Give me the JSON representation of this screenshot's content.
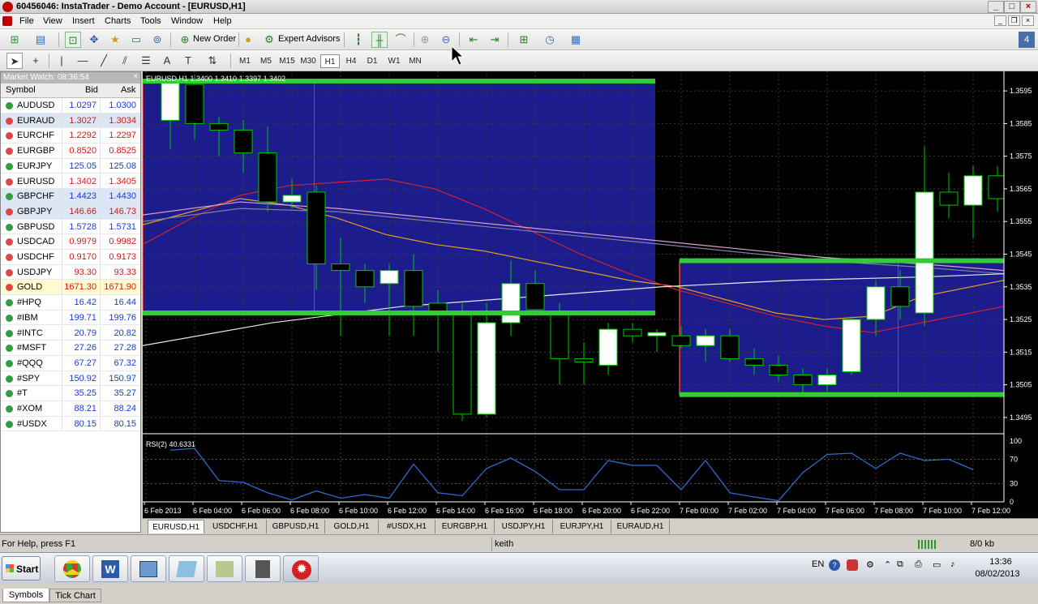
{
  "window": {
    "title": "60456046: InstaTrader - Demo Account - [EURUSD,H1]"
  },
  "menu": {
    "items": [
      "File",
      "View",
      "Insert",
      "Charts",
      "Tools",
      "Window",
      "Help"
    ]
  },
  "toolbar": {
    "new_order": "New Order",
    "expert_advisors": "Expert Advisors"
  },
  "timeframes": [
    "M1",
    "M5",
    "M15",
    "M30",
    "H1",
    "H4",
    "D1",
    "W1",
    "MN"
  ],
  "active_timeframe": "H1",
  "market_watch": {
    "title": "Market Watch: 08:36:54",
    "columns": [
      "Symbol",
      "Bid",
      "Ask"
    ],
    "rows": [
      {
        "symbol": "AUDUSD",
        "bid": "1.0297",
        "ask": "1.0300",
        "dir": "up"
      },
      {
        "symbol": "EURAUD",
        "bid": "1.3027",
        "ask": "1.3034",
        "dir": "down"
      },
      {
        "symbol": "EURCHF",
        "bid": "1.2292",
        "ask": "1.2297",
        "dir": "down"
      },
      {
        "symbol": "EURGBP",
        "bid": "0.8520",
        "ask": "0.8525",
        "dir": "down"
      },
      {
        "symbol": "EURJPY",
        "bid": "125.05",
        "ask": "125.08",
        "dir": "up"
      },
      {
        "symbol": "EURUSD",
        "bid": "1.3402",
        "ask": "1.3405",
        "dir": "down"
      },
      {
        "symbol": "GBPCHF",
        "bid": "1.4423",
        "ask": "1.4430",
        "dir": "up"
      },
      {
        "symbol": "GBPJPY",
        "bid": "146.66",
        "ask": "146.73",
        "dir": "down"
      },
      {
        "symbol": "GBPUSD",
        "bid": "1.5728",
        "ask": "1.5731",
        "dir": "up"
      },
      {
        "symbol": "USDCAD",
        "bid": "0.9979",
        "ask": "0.9982",
        "dir": "down"
      },
      {
        "symbol": "USDCHF",
        "bid": "0.9170",
        "ask": "0.9173",
        "dir": "down"
      },
      {
        "symbol": "USDJPY",
        "bid": "93.30",
        "ask": "93.33",
        "dir": "down"
      },
      {
        "symbol": "GOLD",
        "bid": "1671.30",
        "ask": "1671.90",
        "dir": "down"
      },
      {
        "symbol": "#HPQ",
        "bid": "16.42",
        "ask": "16.44",
        "dir": "up"
      },
      {
        "symbol": "#IBM",
        "bid": "199.71",
        "ask": "199.76",
        "dir": "up"
      },
      {
        "symbol": "#INTC",
        "bid": "20.79",
        "ask": "20.82",
        "dir": "up"
      },
      {
        "symbol": "#MSFT",
        "bid": "27.26",
        "ask": "27.28",
        "dir": "up"
      },
      {
        "symbol": "#QQQ",
        "bid": "67.27",
        "ask": "67.32",
        "dir": "up"
      },
      {
        "symbol": "#SPY",
        "bid": "150.92",
        "ask": "150.97",
        "dir": "up"
      },
      {
        "symbol": "#T",
        "bid": "35.25",
        "ask": "35.27",
        "dir": "up"
      },
      {
        "symbol": "#XOM",
        "bid": "88.21",
        "ask": "88.24",
        "dir": "up"
      },
      {
        "symbol": "#USDX",
        "bid": "80.15",
        "ask": "80.15",
        "dir": "up"
      }
    ],
    "tabs": [
      "Symbols",
      "Tick Chart"
    ]
  },
  "chart": {
    "header": "EURUSD,H1  1.3400 1.3410 1.3397 1.3402",
    "rsi_label": "RSI(2) 40.6331",
    "chart_tabs": [
      "EURUSD,H1",
      "USDCHF,H1",
      "GBPUSD,H1",
      "GOLD,H1",
      "#USDX,H1",
      "EURGBP,H1",
      "USDJPY,H1",
      "EURJPY,H1",
      "EURAUD,H1"
    ],
    "colors": {
      "bull": "#ffffff",
      "bear": "#000000",
      "candle_border": "#00c800",
      "box": "#1c1c8c",
      "box_border": "#ff3b30",
      "green_level": "#32cd32"
    }
  },
  "chart_data": {
    "type": "candlestick",
    "symbol": "EURUSD",
    "timeframe": "H1",
    "y_ticks": [
      "1.3595",
      "1.3585",
      "1.3575",
      "1.3565",
      "1.3555",
      "1.3545",
      "1.3535",
      "1.3525",
      "1.3515",
      "1.3505",
      "1.3495"
    ],
    "x_ticks": [
      "6 Feb 2013",
      "6 Feb 04:00",
      "6 Feb 06:00",
      "6 Feb 08:00",
      "6 Feb 10:00",
      "6 Feb 12:00",
      "6 Feb 14:00",
      "6 Feb 16:00",
      "6 Feb 18:00",
      "6 Feb 20:00",
      "6 Feb 22:00",
      "7 Feb 00:00",
      "7 Feb 02:00",
      "7 Feb 04:00",
      "7 Feb 06:00",
      "7 Feb 08:00",
      "7 Feb 10:00",
      "7 Feb 12:00"
    ],
    "candles": [
      {
        "o": 1.3586,
        "h": 1.3598,
        "l": 1.3577,
        "c": 1.3598
      },
      {
        "o": 1.3597,
        "h": 1.36,
        "l": 1.358,
        "c": 1.3585
      },
      {
        "o": 1.3585,
        "h": 1.3587,
        "l": 1.3575,
        "c": 1.3583
      },
      {
        "o": 1.3583,
        "h": 1.3586,
        "l": 1.357,
        "c": 1.3576
      },
      {
        "o": 1.3576,
        "h": 1.3584,
        "l": 1.3558,
        "c": 1.3561
      },
      {
        "o": 1.3561,
        "h": 1.3568,
        "l": 1.3559,
        "c": 1.3563
      },
      {
        "o": 1.3564,
        "h": 1.3566,
        "l": 1.3534,
        "c": 1.3542
      },
      {
        "o": 1.3542,
        "h": 1.355,
        "l": 1.352,
        "c": 1.354
      },
      {
        "o": 1.354,
        "h": 1.3542,
        "l": 1.353,
        "c": 1.3535
      },
      {
        "o": 1.3536,
        "h": 1.3542,
        "l": 1.352,
        "c": 1.354
      },
      {
        "o": 1.354,
        "h": 1.3545,
        "l": 1.352,
        "c": 1.3529
      },
      {
        "o": 1.353,
        "h": 1.3534,
        "l": 1.3515,
        "c": 1.3527
      },
      {
        "o": 1.3527,
        "h": 1.353,
        "l": 1.3494,
        "c": 1.3496
      },
      {
        "o": 1.3496,
        "h": 1.353,
        "l": 1.3495,
        "c": 1.3524
      },
      {
        "o": 1.3524,
        "h": 1.3543,
        "l": 1.352,
        "c": 1.3536
      },
      {
        "o": 1.3536,
        "h": 1.354,
        "l": 1.3527,
        "c": 1.3528
      },
      {
        "o": 1.3527,
        "h": 1.353,
        "l": 1.3505,
        "c": 1.3513
      },
      {
        "o": 1.3513,
        "h": 1.3518,
        "l": 1.3505,
        "c": 1.3512
      },
      {
        "o": 1.3511,
        "h": 1.3524,
        "l": 1.3508,
        "c": 1.3522
      },
      {
        "o": 1.3522,
        "h": 1.3524,
        "l": 1.3518,
        "c": 1.352
      },
      {
        "o": 1.352,
        "h": 1.3522,
        "l": 1.3515,
        "c": 1.3521
      },
      {
        "o": 1.352,
        "h": 1.3523,
        "l": 1.3516,
        "c": 1.3517
      },
      {
        "o": 1.3517,
        "h": 1.3522,
        "l": 1.3512,
        "c": 1.352
      },
      {
        "o": 1.352,
        "h": 1.3522,
        "l": 1.3512,
        "c": 1.3513
      },
      {
        "o": 1.3513,
        "h": 1.3516,
        "l": 1.3508,
        "c": 1.3511
      },
      {
        "o": 1.3511,
        "h": 1.3514,
        "l": 1.3506,
        "c": 1.3508
      },
      {
        "o": 1.3508,
        "h": 1.351,
        "l": 1.3502,
        "c": 1.3505
      },
      {
        "o": 1.3505,
        "h": 1.351,
        "l": 1.3503,
        "c": 1.3508
      },
      {
        "o": 1.3509,
        "h": 1.3526,
        "l": 1.3508,
        "c": 1.3525
      },
      {
        "o": 1.3525,
        "h": 1.3537,
        "l": 1.352,
        "c": 1.3535
      },
      {
        "o": 1.3535,
        "h": 1.354,
        "l": 1.3525,
        "c": 1.3529
      },
      {
        "o": 1.3527,
        "h": 1.3578,
        "l": 1.3523,
        "c": 1.3564
      },
      {
        "o": 1.3564,
        "h": 1.357,
        "l": 1.3556,
        "c": 1.356
      },
      {
        "o": 1.356,
        "h": 1.3572,
        "l": 1.355,
        "c": 1.3569
      },
      {
        "o": 1.3569,
        "h": 1.3572,
        "l": 1.3558,
        "c": 1.3562
      }
    ],
    "rsi": [
      85,
      88,
      35,
      32,
      15,
      3,
      18,
      6,
      12,
      6,
      62,
      15,
      10,
      55,
      72,
      50,
      20,
      20,
      68,
      60,
      60,
      20,
      68,
      15,
      8,
      2,
      48,
      78,
      80,
      55,
      80,
      68,
      70,
      53
    ],
    "rsi_levels": [
      100,
      70,
      30,
      0
    ]
  },
  "status": {
    "help": "For Help, press F1",
    "profile": "keith",
    "traffic": "8/0 kb"
  },
  "taskbar": {
    "start": "Start",
    "lang": "EN",
    "time": "13:36",
    "date": "08/02/2013"
  }
}
